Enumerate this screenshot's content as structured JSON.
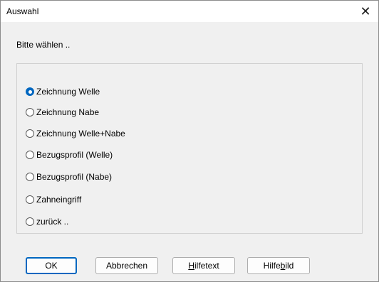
{
  "window": {
    "title": "Auswahl",
    "close_glyph": "✕"
  },
  "prompt": "Bitte wählen ..",
  "options": [
    {
      "label": "Zeichnung Welle",
      "checked": true
    },
    {
      "label": "Zeichnung Nabe",
      "checked": false
    },
    {
      "label": "Zeichnung Welle+Nabe",
      "checked": false
    },
    {
      "label": "Bezugsprofil (Welle)",
      "checked": false
    },
    {
      "label": "Bezugsprofil (Nabe)",
      "checked": false
    },
    {
      "label": "Zahneingriff",
      "checked": false
    },
    {
      "label": "zurück ..",
      "checked": false
    }
  ],
  "buttons": {
    "ok": "OK",
    "cancel": "Abbrechen",
    "helptext": {
      "pre": "",
      "accel": "H",
      "post": "ilfetext"
    },
    "helpimage": {
      "pre": "Hilfe",
      "accel": "b",
      "post": "ild"
    }
  },
  "colors": {
    "accent": "#0067c0"
  }
}
